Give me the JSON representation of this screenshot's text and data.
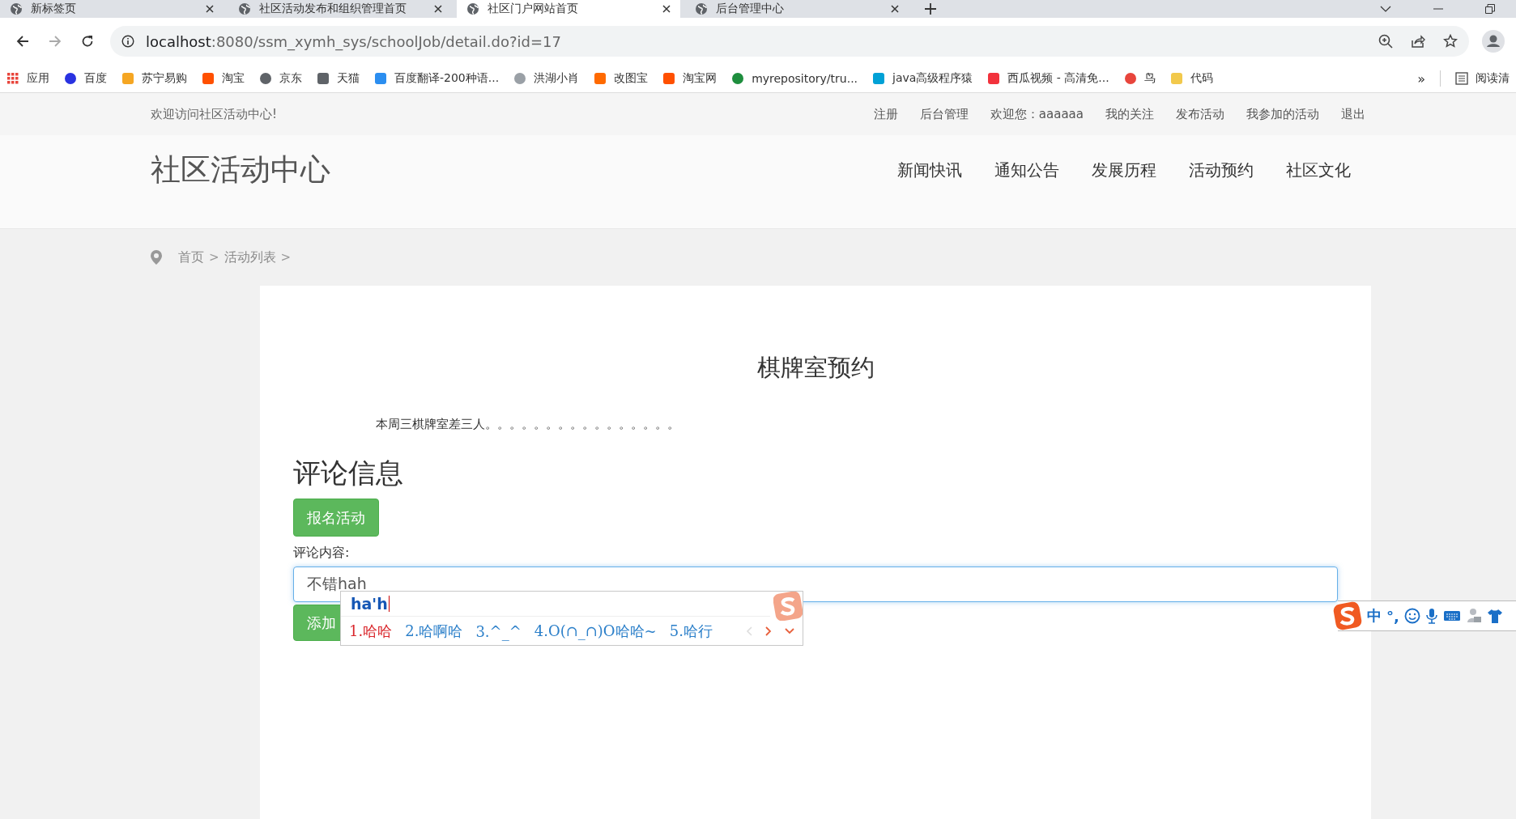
{
  "browser": {
    "tabs": [
      {
        "title": "新标签页",
        "selected": false
      },
      {
        "title": "社区活动发布和组织管理首页",
        "selected": false
      },
      {
        "title": "社区门户网站首页",
        "selected": true
      },
      {
        "title": "后台管理中心",
        "selected": false
      }
    ],
    "url": {
      "host": "localhost",
      "path": ":8080/ssm_xymh_sys/schoolJob/detail.do?id=17"
    },
    "bookmarks": [
      {
        "label": "应用",
        "color": "#e8453c"
      },
      {
        "label": "百度",
        "color": "#2932e1"
      },
      {
        "label": "苏宁易购",
        "color": "#f5a623"
      },
      {
        "label": "淘宝",
        "color": "#ff5000"
      },
      {
        "label": "京东",
        "color": "#5f6368"
      },
      {
        "label": "天猫",
        "color": "#5f6368"
      },
      {
        "label": "百度翻译-200种语...",
        "color": "#2b8ef0"
      },
      {
        "label": "洪湖小肖",
        "color": "#9aa0a6"
      },
      {
        "label": "改图宝",
        "color": "#ff6a00"
      },
      {
        "label": "淘宝网",
        "color": "#ff5000"
      },
      {
        "label": "myrepository/tru...",
        "color": "#1e8e3e"
      },
      {
        "label": "java高级程序猿",
        "color": "#00a1d6"
      },
      {
        "label": "西瓜视频 - 高清免...",
        "color": "#f2323c"
      },
      {
        "label": "鸟",
        "color": "#e8453c"
      },
      {
        "label": "代码",
        "color": "#f2c94c"
      }
    ],
    "more": "»",
    "reading_list": "阅读清"
  },
  "site": {
    "welcome": "欢迎访问社区活动中心!",
    "top_links": [
      "注册",
      "后台管理",
      "欢迎您：aaaaaa",
      "我的关注",
      "发布活动",
      "我参加的活动",
      "退出"
    ],
    "logo": "社区活动中心",
    "nav": [
      "新闻快讯",
      "通知公告",
      "发展历程",
      "活动预约",
      "社区文化"
    ],
    "breadcrumb": [
      {
        "kind": "link",
        "text": "首页"
      },
      {
        "kind": "separator",
        "text": ">"
      },
      {
        "kind": "link",
        "text": "活动列表"
      },
      {
        "kind": "separator",
        "text": ">"
      }
    ]
  },
  "article": {
    "title": "棋牌室预约",
    "body": "本周三棋牌室差三人。。。。。。。。。。。。。。。。",
    "comments_heading": "评论信息",
    "signup_button": "报名活动",
    "comment_label": "评论内容:",
    "comment_value": "不错hah",
    "add_button": "添加"
  },
  "ime": {
    "composition": "ha'h",
    "candidates": [
      {
        "text": "1.哈哈",
        "selected": true
      },
      {
        "text": "2.哈啊哈",
        "selected": false
      },
      {
        "text": "3.^_^",
        "selected": false
      },
      {
        "text": "4.O(∩_∩)O哈哈~",
        "selected": false
      },
      {
        "text": "5.哈行",
        "selected": false
      }
    ],
    "toolbar": [
      "中",
      "°,"
    ]
  }
}
